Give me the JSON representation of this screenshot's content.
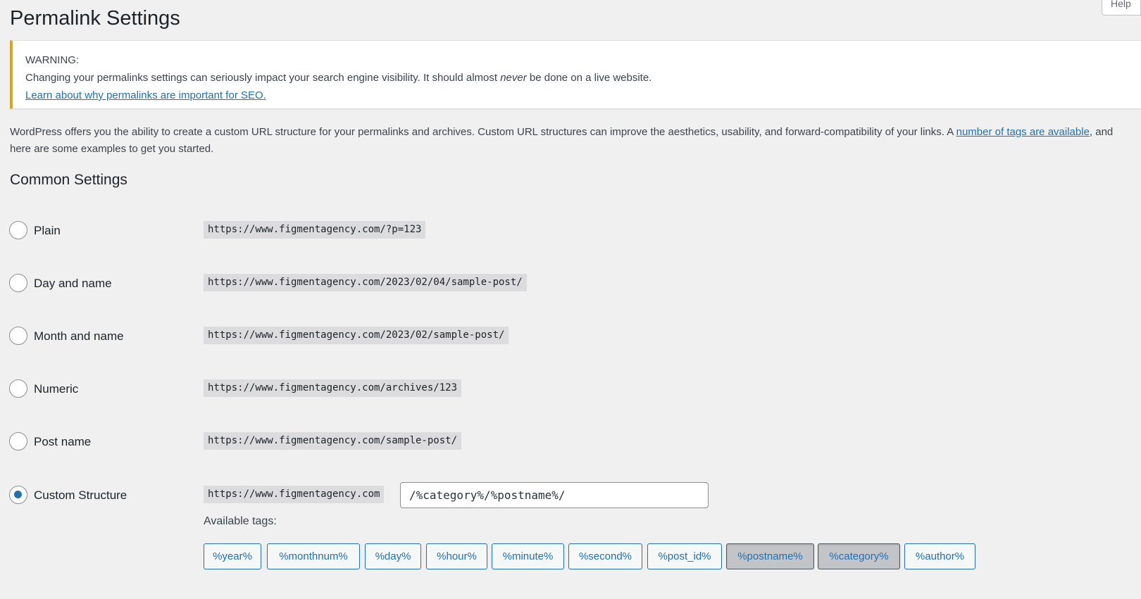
{
  "header": {
    "title": "Permalink Settings",
    "help_tab": "Help"
  },
  "notice": {
    "heading": "WARNING:",
    "text_before": "Changing your permalinks settings can seriously impact your search engine visibility. It should almost ",
    "emphasis": "never",
    "text_after": " be done on a live website.",
    "link": "Learn about why permalinks are important for SEO.",
    "border_color": "#dba617"
  },
  "intro": {
    "text_before": "WordPress offers you the ability to create a custom URL structure for your permalinks and archives. Custom URL structures can improve the aesthetics, usability, and forward-compatibility of your links. A ",
    "link": "number of tags are available",
    "text_after": ", and here are some examples to get you started."
  },
  "common": {
    "title": "Common Settings",
    "options": [
      {
        "label": "Plain",
        "example": "https://www.figmentagency.com/?p=123",
        "checked": false
      },
      {
        "label": "Day and name",
        "example": "https://www.figmentagency.com/2023/02/04/sample-post/",
        "checked": false
      },
      {
        "label": "Month and name",
        "example": "https://www.figmentagency.com/2023/02/sample-post/",
        "checked": false
      },
      {
        "label": "Numeric",
        "example": "https://www.figmentagency.com/archives/123",
        "checked": false
      },
      {
        "label": "Post name",
        "example": "https://www.figmentagency.com/sample-post/",
        "checked": false
      },
      {
        "label": "Custom Structure",
        "example": "https://www.figmentagency.com",
        "checked": true
      }
    ],
    "custom_value": "/%category%/%postname%/",
    "available_tags_label": "Available tags:",
    "tags": [
      {
        "label": "%year%",
        "active": false
      },
      {
        "label": "%monthnum%",
        "active": false
      },
      {
        "label": "%day%",
        "active": false
      },
      {
        "label": "%hour%",
        "active": false
      },
      {
        "label": "%minute%",
        "active": false
      },
      {
        "label": "%second%",
        "active": false
      },
      {
        "label": "%post_id%",
        "active": false
      },
      {
        "label": "%postname%",
        "active": true
      },
      {
        "label": "%category%",
        "active": true
      },
      {
        "label": "%author%",
        "active": false
      }
    ]
  },
  "colors": {
    "link": "#2271b1",
    "background": "#f0f0f1"
  }
}
